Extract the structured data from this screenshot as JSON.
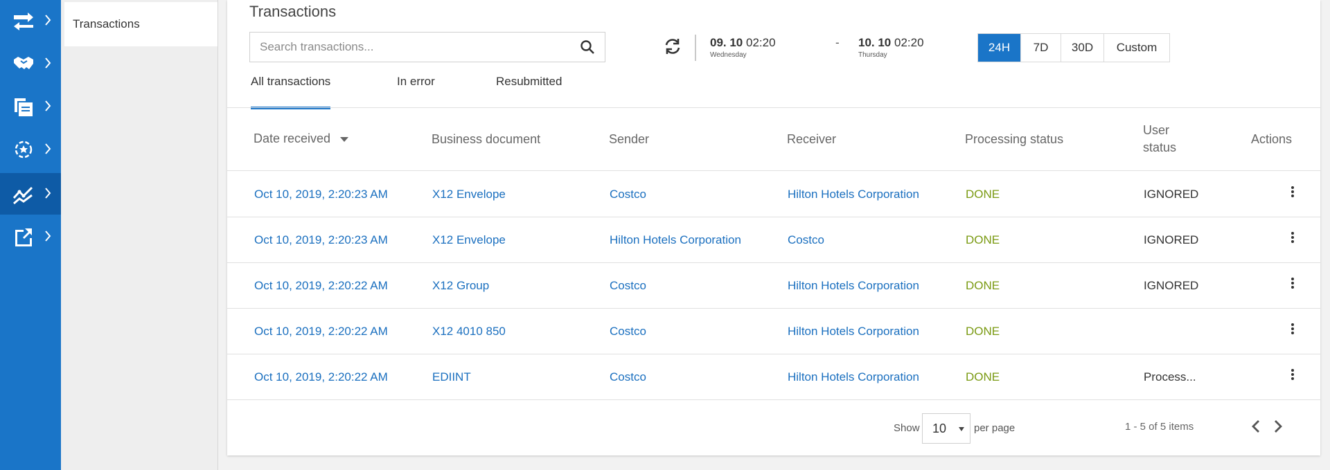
{
  "sidebar": {
    "items": [
      {
        "icon": "exchange-arrows-icon"
      },
      {
        "icon": "handshake-icon"
      },
      {
        "icon": "documents-icon"
      },
      {
        "icon": "gear-star-icon"
      },
      {
        "icon": "analytics-trend-icon"
      },
      {
        "icon": "external-link-icon"
      }
    ],
    "active_index": 4,
    "submenu_item": "Transactions"
  },
  "main": {
    "title": "Transactions",
    "search_placeholder": "Search transactions...",
    "date_from": {
      "day": "09. 10",
      "time": "02:20",
      "weekday": "Wednesday"
    },
    "date_separator": "-",
    "date_to": {
      "day": "10. 10",
      "time": "02:20",
      "weekday": "Thursday"
    },
    "ranges": [
      "24H",
      "7D",
      "30D",
      "Custom"
    ],
    "active_range": "24H",
    "tabs": [
      "All transactions",
      "In error",
      "Resubmitted"
    ],
    "active_tab": "All transactions"
  },
  "table": {
    "headers": {
      "date_received": "Date received",
      "business_document": "Business document",
      "sender": "Sender",
      "receiver": "Receiver",
      "processing_status": "Processing status",
      "user_status_line1": "User",
      "user_status_line2": "status",
      "actions": "Actions"
    },
    "rows": [
      {
        "date": "Oct 10, 2019, 2:20:23 AM",
        "document": "X12 Envelope",
        "sender": "Costco",
        "receiver": "Hilton Hotels Corporation",
        "status": "DONE",
        "user_status": "IGNORED"
      },
      {
        "date": "Oct 10, 2019, 2:20:23 AM",
        "document": "X12 Envelope",
        "sender": "Hilton Hotels Corporation",
        "receiver": "Costco",
        "status": "DONE",
        "user_status": "IGNORED"
      },
      {
        "date": "Oct 10, 2019, 2:20:22 AM",
        "document": "X12 Group",
        "sender": "Costco",
        "receiver": "Hilton Hotels Corporation",
        "status": "DONE",
        "user_status": "IGNORED"
      },
      {
        "date": "Oct 10, 2019, 2:20:22 AM",
        "document": "X12 4010 850",
        "sender": "Costco",
        "receiver": "Hilton Hotels Corporation",
        "status": "DONE",
        "user_status": ""
      },
      {
        "date": "Oct 10, 2019, 2:20:22 AM",
        "document": "EDIINT",
        "sender": "Costco",
        "receiver": "Hilton Hotels Corporation",
        "status": "DONE",
        "user_status": "Process..."
      }
    ]
  },
  "pagination": {
    "show_label": "Show",
    "per_page_value": "10",
    "per_page_label": "per page",
    "items_summary": "1 - 5 of 5 items"
  },
  "colors": {
    "brand": "#1a75c8",
    "link": "#1a6fbf",
    "status_done": "#7a9a12"
  }
}
